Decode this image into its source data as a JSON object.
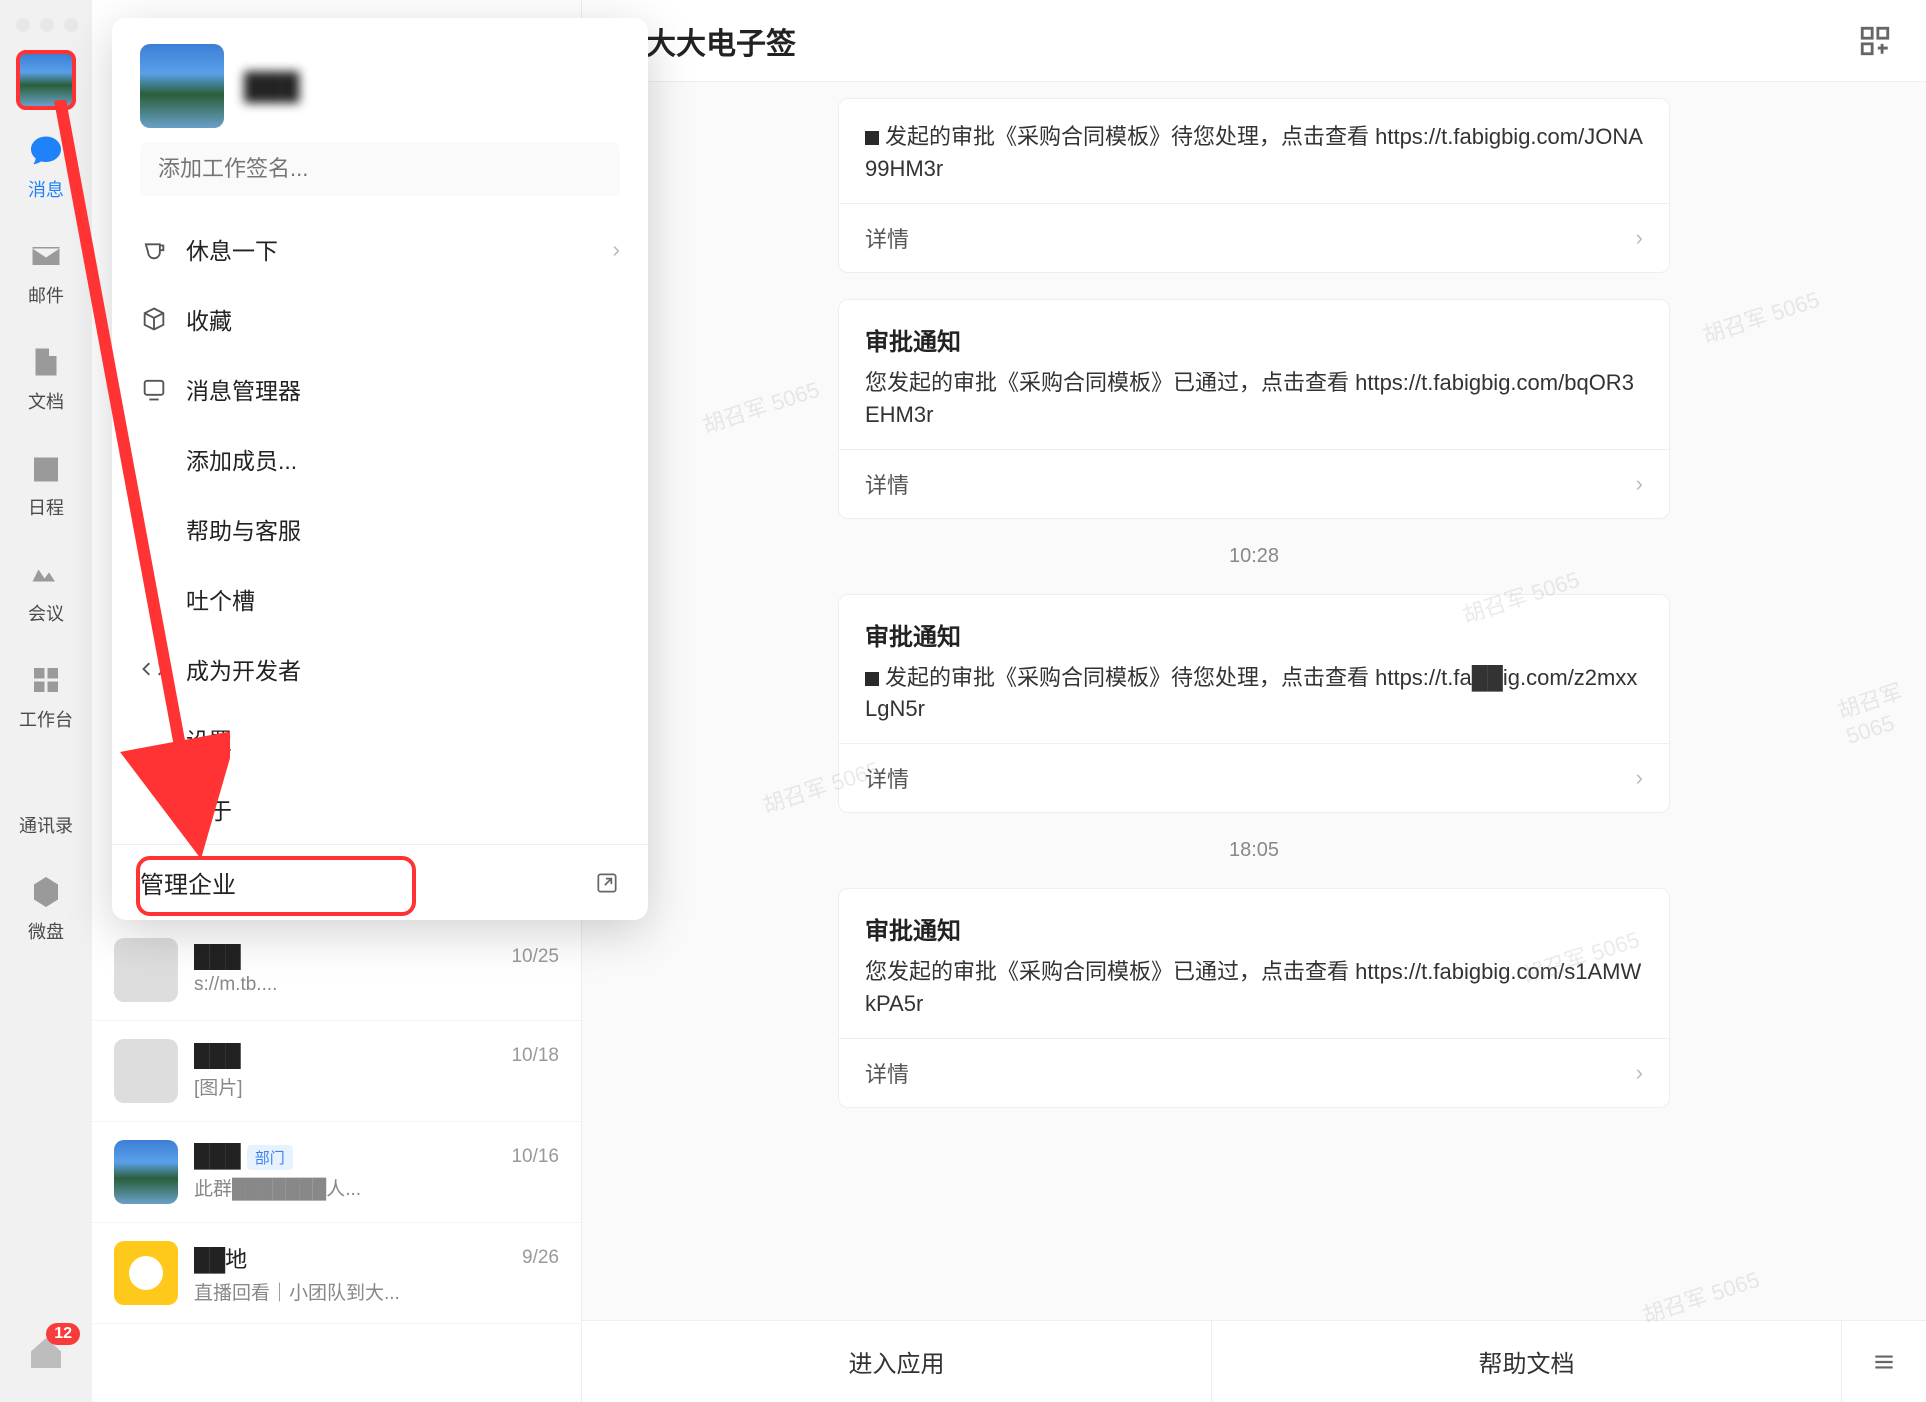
{
  "sidebar": {
    "items": [
      {
        "label": "消息",
        "icon": "chat"
      },
      {
        "label": "邮件",
        "icon": "mail"
      },
      {
        "label": "文档",
        "icon": "doc"
      },
      {
        "label": "日程",
        "icon": "calendar"
      },
      {
        "label": "会议",
        "icon": "meeting"
      },
      {
        "label": "工作台",
        "icon": "grid"
      },
      {
        "label": "通讯录",
        "icon": "contacts"
      },
      {
        "label": "微盘",
        "icon": "disk"
      }
    ],
    "badge": "12"
  },
  "popover": {
    "username": "███",
    "signature_placeholder": "添加工作签名...",
    "items": [
      {
        "label": "休息一下",
        "icon": "cup",
        "chevron": true
      },
      {
        "label": "收藏",
        "icon": "cube"
      },
      {
        "label": "消息管理器",
        "icon": "msgbox"
      },
      {
        "label": "添加成员...",
        "no_icon": true
      },
      {
        "label": "帮助与客服",
        "no_icon": true
      },
      {
        "label": "吐个槽",
        "no_icon": true
      },
      {
        "label": "成为开发者",
        "icon": "code"
      },
      {
        "label": "设置",
        "no_icon": true
      },
      {
        "label": "关于",
        "no_icon": true
      }
    ],
    "footer": "管理企业"
  },
  "chatlist": [
    {
      "name": "███",
      "sub": "s://m.tb....",
      "date": "10/25"
    },
    {
      "name": "███",
      "sub": "[图片]",
      "date": "10/18"
    },
    {
      "name": "███",
      "tag": "部门",
      "sub": "此群███████人...",
      "date": "10/16",
      "scenic": true
    },
    {
      "name": "██地",
      "sub": "直播回看｜小团队到大...",
      "date": "9/26",
      "yellow": true
    }
  ],
  "main": {
    "title": "法大大电子签",
    "enter_app": "进入应用",
    "help_doc": "帮助文档",
    "cards": [
      {
        "title": "",
        "text_prefix": "■ ",
        "text": "发起的审批《采购合同模板》待您处理，点击查看 https://t.fabigbig.com/JONA99HM3r",
        "detail": "详情"
      },
      {
        "time": "",
        "title": "审批通知",
        "text": "您发起的审批《采购合同模板》已通过，点击查看 https://t.fabigbig.com/bqOR3EHM3r",
        "detail": "详情"
      },
      {
        "time": "10:28",
        "title": "审批通知",
        "text_prefix": "■ ",
        "text": "发起的审批《采购合同模板》待您处理，点击查看 https://t.fa██ig.com/z2mxxLgN5r",
        "detail": "详情"
      },
      {
        "time": "18:05",
        "title": "审批通知",
        "text": "您发起的审批《采购合同模板》已通过，点击查看 https://t.fabigbig.com/s1AMWkPA5r",
        "detail": "详情"
      }
    ]
  },
  "watermark": "胡召军 5065"
}
